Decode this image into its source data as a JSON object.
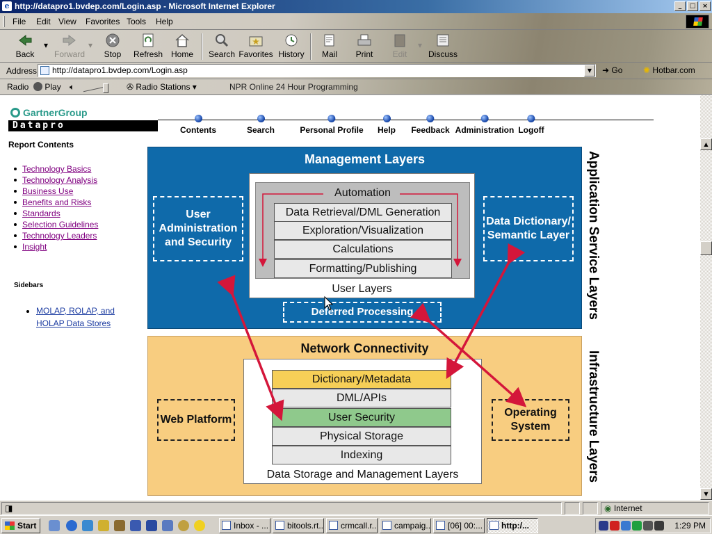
{
  "window": {
    "title": "http://datapro1.bvdep.com/Login.asp - Microsoft Internet Explorer",
    "controls": [
      "_",
      "□",
      "×"
    ]
  },
  "menu": [
    "File",
    "Edit",
    "View",
    "Favorites",
    "Tools",
    "Help"
  ],
  "toolbar": {
    "back": "Back",
    "forward": "Forward",
    "stop": "Stop",
    "refresh": "Refresh",
    "home": "Home",
    "search": "Search",
    "favorites": "Favorites",
    "history": "History",
    "mail": "Mail",
    "print": "Print",
    "edit": "Edit",
    "discuss": "Discuss"
  },
  "address": {
    "label": "Address",
    "url": "http://datapro1.bvdep.com/Login.asp",
    "go": "Go",
    "hotbar": "Hotbar.com"
  },
  "radio": {
    "label": "Radio",
    "play": "Play",
    "stations": "Radio Stations",
    "now_playing": "NPR Online 24 Hour Programming"
  },
  "site": {
    "logo": "GartnerGroup",
    "brand": "Datapro",
    "nav": [
      "Contents",
      "Search",
      "Personal Profile",
      "Help",
      "Feedback",
      "Administration",
      "Logoff"
    ]
  },
  "sidebar": {
    "title": "Report Contents",
    "items": [
      "Technology Basics",
      "Technology Analysis",
      "Business Use",
      "Benefits and Risks",
      "Standards",
      "Selection Guidelines",
      "Technology Leaders",
      "Insight"
    ],
    "sidebars_title": "Sidebars",
    "sidebar_link": "MOLAP, ROLAP, and HOLAP Data Stores"
  },
  "diagram": {
    "management_title": "Management Layers",
    "user_admin": "User Administration and Security",
    "data_dictionary": "Data Dictionary/ Semantic Layer",
    "automation": "Automation",
    "user_layers": [
      "Data Retrieval/DML Generation",
      "Exploration/Visualization",
      "Calculations",
      "Formatting/Publishing"
    ],
    "user_layers_caption": "User Layers",
    "deferred": "Deferred Processing",
    "network_title": "Network Connectivity",
    "web_platform": "Web Platform",
    "operating_system": "Operating System",
    "storage_layers": [
      "Dictionary/Metadata",
      "DML/APIs",
      "User Security",
      "Physical Storage",
      "Indexing"
    ],
    "storage_caption": "Data Storage and Management Layers",
    "app_service_label": "Application Service Layers",
    "infra_label": "Infrastructure Layers",
    "colors": {
      "management": "#0f6aaa",
      "infrastructure": "#f8cd80",
      "dictionary": "#f6cf57",
      "user_security": "#8fc98c",
      "arrow": "#d4163a"
    }
  },
  "status": {
    "zone": "Internet"
  },
  "taskbar": {
    "start": "Start",
    "tasks": [
      "Inbox - ...",
      "bitools.rt...",
      "crmcall.r...",
      "campaig...",
      "[06] 00:...",
      "http:/..."
    ],
    "clock": "1:29 PM"
  }
}
